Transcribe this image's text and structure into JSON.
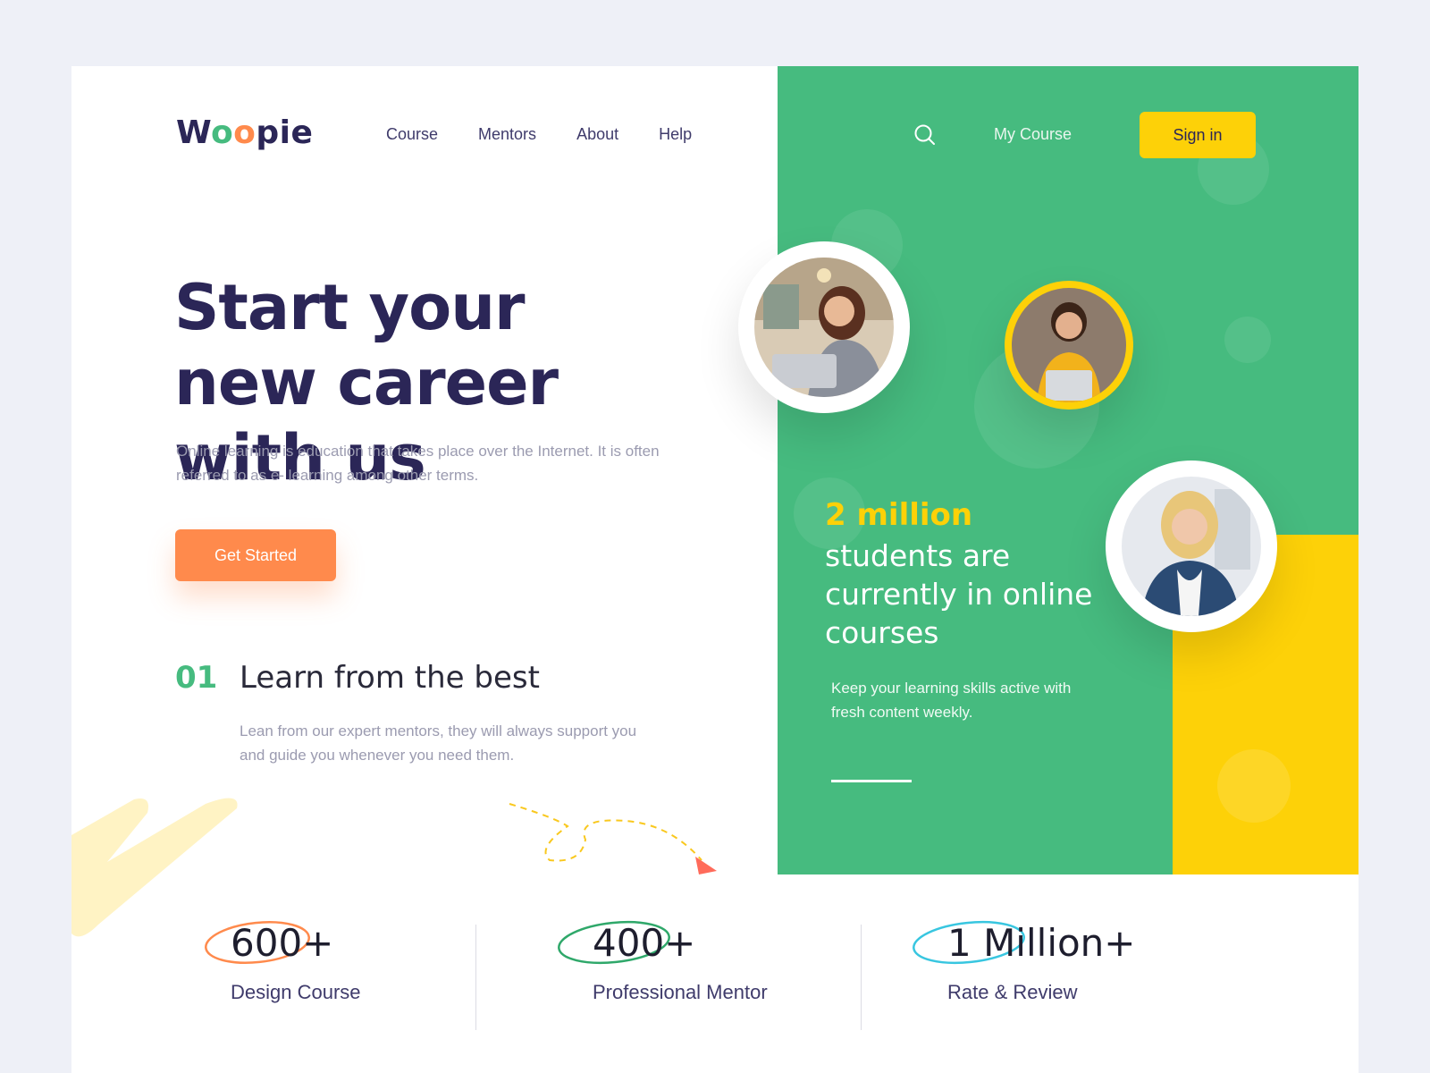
{
  "brand": {
    "name_parts": [
      "W",
      "o",
      "o",
      "pie"
    ]
  },
  "nav": {
    "items": [
      "Course",
      "Mentors",
      "About",
      "Help"
    ],
    "my_course": "My Course",
    "sign_in": "Sign in"
  },
  "hero": {
    "title": "Start your new career with us",
    "subtitle": "Online learning is education that takes place over the Internet. It is often referred to as e- learning among other terms.",
    "cta": "Get Started"
  },
  "feature": {
    "number": "01",
    "title": "Learn from the best",
    "description": "Lean from our expert mentors, they will always support you and guide you whenever you need them."
  },
  "panel": {
    "highlight": "2 million",
    "heading": "students are currently in online courses",
    "description": "Keep your learning skills active with fresh content weekly."
  },
  "stats": [
    {
      "value": "600+",
      "label": "Design Course",
      "color": "#ff8a4c"
    },
    {
      "value": "400+",
      "label": "Professional Mentor",
      "color": "#2fa86a"
    },
    {
      "value": "1 Million+",
      "label": "Rate & Review",
      "color": "#38c6e0"
    }
  ],
  "colors": {
    "navy": "#2b2657",
    "green": "#46bb7f",
    "orange": "#ff8a4c",
    "yellow": "#fdd108"
  },
  "icons": {
    "search": "search-icon"
  }
}
